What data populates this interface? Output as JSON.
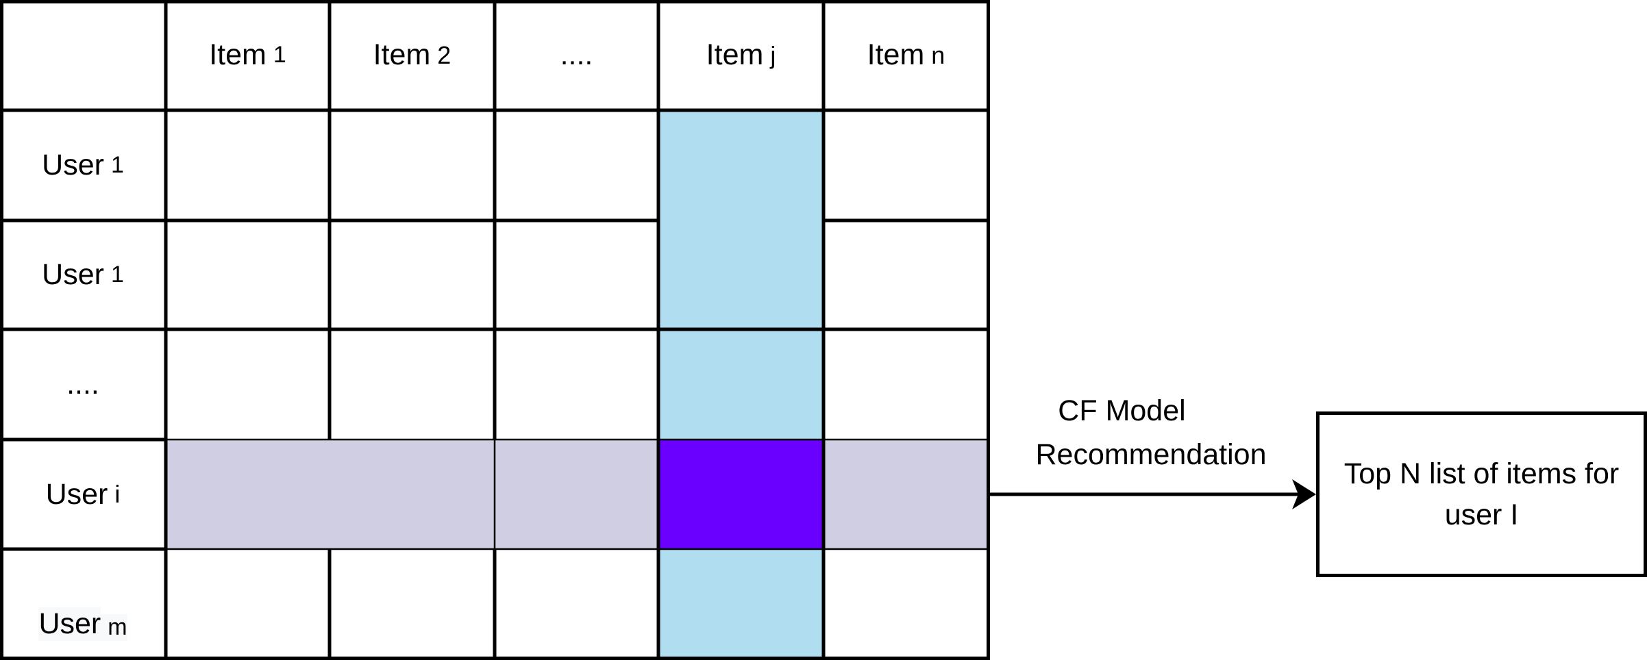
{
  "matrix": {
    "column_headers": [
      {
        "main": "Item",
        "sub": "1"
      },
      {
        "main": "Item",
        "sub": "2"
      },
      {
        "main": "....",
        "sub": ""
      },
      {
        "main": "Item",
        "sub": "j"
      },
      {
        "main": "Item",
        "sub": "n"
      }
    ],
    "row_headers": [
      {
        "main": "User",
        "sub": "1"
      },
      {
        "main": "User",
        "sub": "1"
      },
      {
        "main": "....",
        "sub": ""
      },
      {
        "main": "User",
        "sub": "i"
      },
      {
        "main": "User",
        "sub": "m"
      }
    ],
    "highlight": {
      "target_row": "User i",
      "target_column": "Item j",
      "column_color": "#b1ddf0",
      "row_color": "#d0cee2",
      "intersection_color": "#6a00ff"
    }
  },
  "arrow": {
    "label_line1": "CF Model",
    "label_line2": "Recommendation"
  },
  "output_box": {
    "line1": "Top N list of items for",
    "line2": "user I"
  }
}
